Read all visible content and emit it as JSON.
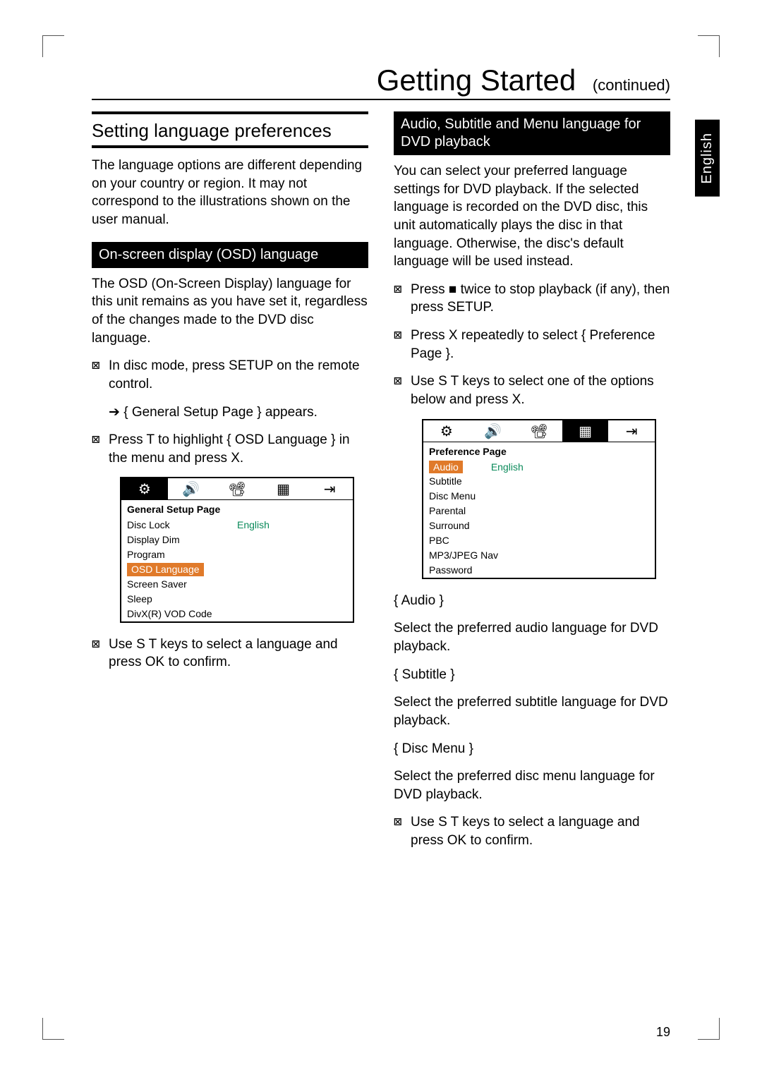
{
  "page_number": "19",
  "side_tab": "English",
  "title": "Getting Started",
  "title_suffix": "(continued)",
  "left": {
    "section": "Setting language preferences",
    "intro": "The language options are different depending on your country or region. It may not correspond to the illustrations shown on the user manual.",
    "bar": "On-screen display (OSD) language",
    "osd_intro": "The OSD (On-Screen Display) language for this unit remains as you have set it, regardless of the changes made to the DVD disc language.",
    "step1": "In disc mode, press SETUP on the remote control.",
    "step1_sub": "{ General Setup Page } appears.",
    "step2": "Press T to highlight { OSD Language } in the menu and press X.",
    "step3": "Use S T keys to select a language and press OK to confirm.",
    "menu": {
      "title": "General Setup Page",
      "items": [
        "Disc Lock",
        "Display Dim",
        "Program",
        "OSD Language",
        "Screen Saver",
        "Sleep",
        "DivX(R) VOD Code"
      ],
      "selected_index": 3,
      "selected_value": "English"
    }
  },
  "right": {
    "bar": "Audio, Subtitle and Menu language for DVD playback",
    "intro": "You can select your preferred language settings for DVD playback. If the selected language is recorded on the DVD disc, this unit automatically plays the disc in that language. Otherwise, the disc's default language will be used instead.",
    "step1": "Press ■ twice to stop playback (if any), then press SETUP.",
    "step2": "Press X repeatedly to select { Preference Page }.",
    "step3": "Use S T keys to select one of the options below and press X.",
    "menu": {
      "title": "Preference Page",
      "items": [
        "Audio",
        "Subtitle",
        "Disc Menu",
        "Parental",
        "Surround",
        "PBC",
        "MP3/JPEG Nav",
        "Password"
      ],
      "selected_index": 0,
      "selected_value": "English"
    },
    "opt_audio_h": "{ Audio }",
    "opt_audio_t": "Select the preferred audio language for DVD playback.",
    "opt_sub_h": "{ Subtitle }",
    "opt_sub_t": "Select the preferred subtitle language for DVD playback.",
    "opt_menu_h": "{ Disc Menu }",
    "opt_menu_t": "Select the preferred disc menu language for DVD playback.",
    "step4": "Use S T keys to select a language and press OK to confirm."
  },
  "icons": {
    "settings": "⚙",
    "audio": "🔊",
    "video": "📽",
    "grid": "▦",
    "out": "⇥"
  }
}
